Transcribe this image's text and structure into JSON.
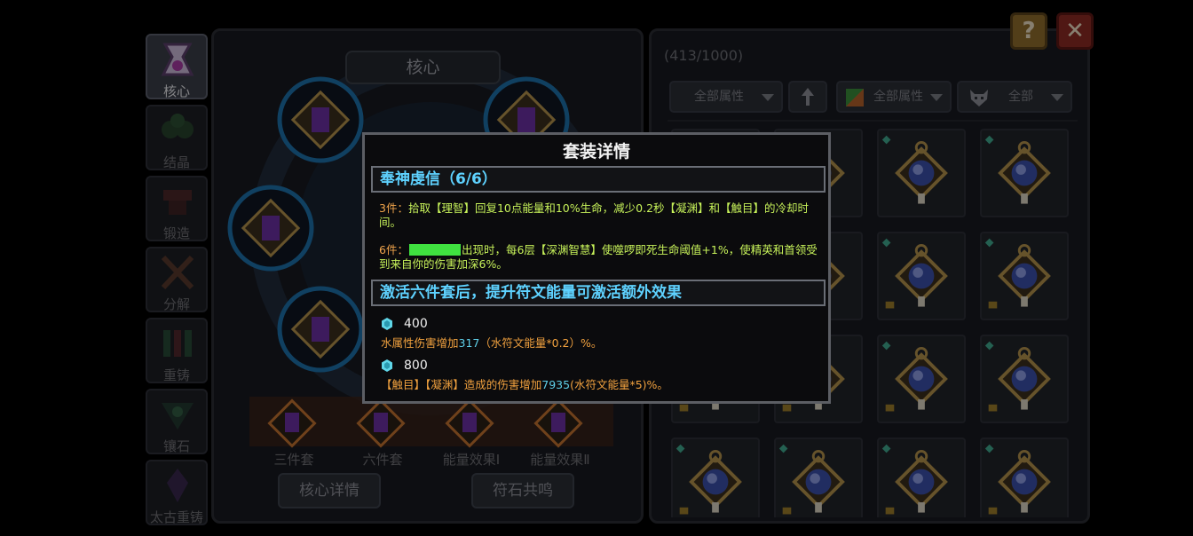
{
  "side_tabs": [
    {
      "label": "核心",
      "icon": "core-icon",
      "active": true
    },
    {
      "label": "结晶",
      "icon": "crystal-icon",
      "active": false
    },
    {
      "label": "锻造",
      "icon": "anvil-icon",
      "active": false
    },
    {
      "label": "分解",
      "icon": "disassemble-icon",
      "active": false
    },
    {
      "label": "重铸",
      "icon": "recast-icon",
      "active": false
    },
    {
      "label": "镶石",
      "icon": "inlay-icon",
      "active": false
    },
    {
      "label": "太古重铸",
      "icon": "ancient-recast-icon",
      "active": false
    }
  ],
  "core_panel": {
    "title": "核心",
    "slot_labels": [
      "三件套",
      "六件套",
      "能量效果Ⅰ",
      "能量效果Ⅱ"
    ],
    "buttons": {
      "details": "核心详情",
      "resonance": "符石共鸣"
    }
  },
  "inventory": {
    "count": "(413/1000)",
    "filters": {
      "attr": "全部属性",
      "element": "全部属性",
      "category": "全部"
    }
  },
  "popup": {
    "title": "套装详情",
    "set_name": "奉神虔信（6/6）",
    "bonus3": {
      "prefix": "3件：",
      "text": "拾取【理智】回复10点能量和10%生命，减少0.2秒【凝渊】和【触目】的冷却时间。"
    },
    "bonus6": {
      "prefix": "6件：",
      "text": "出现时，每6层【深渊智慧】使噬啰即死生命阈值+1%，使精英和首领受到来自你的伤害加深6%。"
    },
    "energy_header": "激活六件套后，提升符文能量可激活额外效果",
    "tier1": {
      "value": "400",
      "pre": "水属性伤害增加",
      "num": "317",
      "post": "（水符文能量*0.2）%。"
    },
    "tier2": {
      "value": "800",
      "pre": "【触目】【凝渊】造成的伤害增加",
      "num": "7935",
      "post": "(水符文能量*5)%。"
    }
  },
  "colors": {
    "accent_cyan": "#5ed2ff",
    "text_green": "#c7f25a",
    "text_orange": "#f2a23f"
  }
}
